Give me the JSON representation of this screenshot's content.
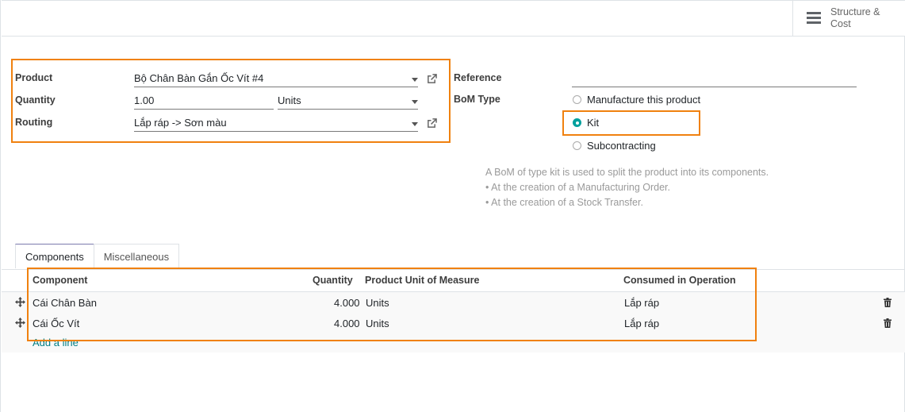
{
  "header": {
    "smart_button_label": "Structure &\nCost"
  },
  "form": {
    "product_label": "Product",
    "product_value": "Bộ Chân Bàn Gắn Ốc Vít #4",
    "quantity_label": "Quantity",
    "quantity_value": "1.00",
    "uom_value": "Units",
    "routing_label": "Routing",
    "routing_value": "Lắp ráp -> Sơn màu",
    "reference_label": "Reference",
    "reference_value": "",
    "bom_type_label": "BoM Type",
    "bom_type_options": [
      "Manufacture this product",
      "Kit",
      "Subcontracting"
    ],
    "bom_type_selected": "Kit"
  },
  "help": {
    "line1": "A BoM of type kit is used to split the product into its components.",
    "line2": "• At the creation of a Manufacturing Order.",
    "line3": "• At the creation of a Stock Transfer."
  },
  "tabs": [
    "Components",
    "Miscellaneous"
  ],
  "table": {
    "headers": [
      "Component",
      "Quantity",
      "Product Unit of Measure",
      "Consumed in Operation"
    ],
    "rows": [
      {
        "component": "Cái Chân Bàn",
        "quantity": "4.000",
        "uom": "Units",
        "operation": "Lắp ráp"
      },
      {
        "component": "Cái Ốc Vít",
        "quantity": "4.000",
        "uom": "Units",
        "operation": "Lắp ráp"
      }
    ],
    "add_line": "Add a line"
  },
  "colors": {
    "accent": "#00a09d",
    "highlight": "#f0810f",
    "link": "#017e84",
    "tab_active_top": "#7c7bad"
  },
  "icons": [
    "menu-icon",
    "caret-down-icon",
    "external-link-icon",
    "drag-handle-icon",
    "trash-icon"
  ]
}
